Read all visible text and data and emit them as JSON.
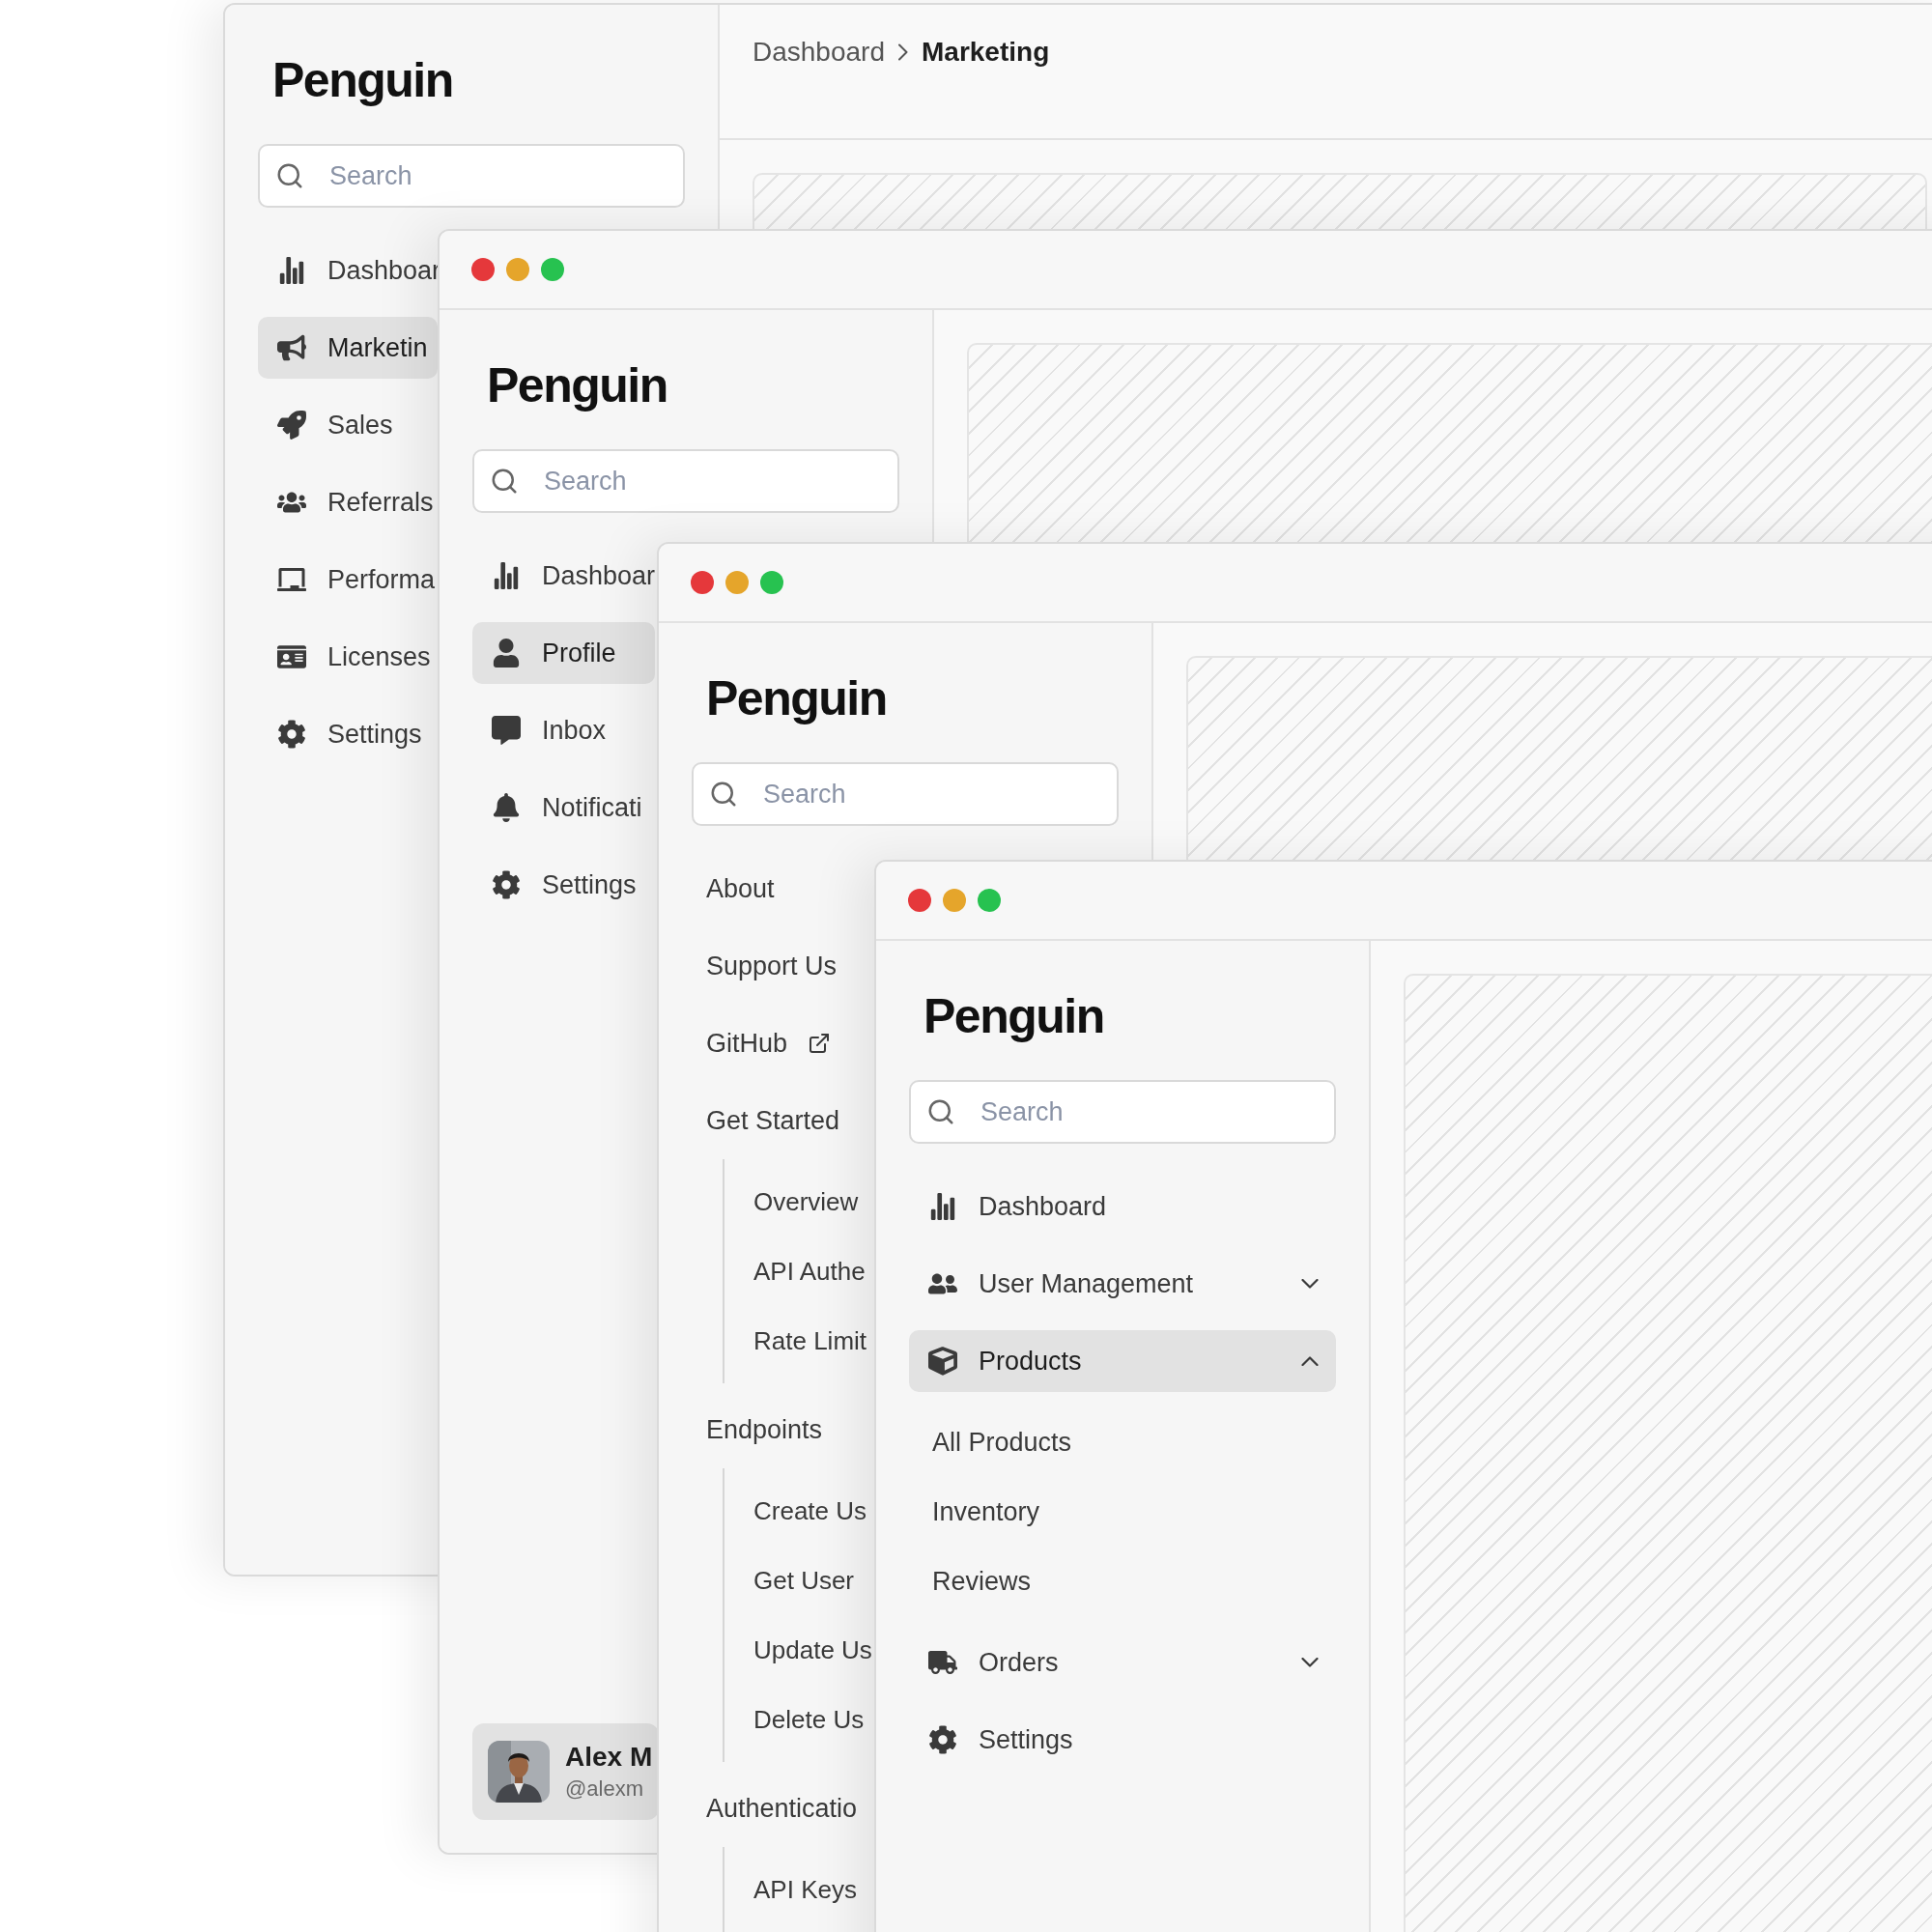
{
  "windows": [
    {
      "traffic_lights": false,
      "logo": "Penguin",
      "search": {
        "placeholder": "Search"
      },
      "breadcrumb": [
        {
          "label": "Dashboard",
          "current": false
        },
        {
          "label": "Marketing",
          "current": true
        }
      ],
      "nav": [
        {
          "kind": "nav",
          "label": "Dashboar",
          "selected": false
        },
        {
          "kind": "nav",
          "label": "Marketin",
          "selected": true
        },
        {
          "kind": "nav",
          "label": "Sales",
          "selected": false
        },
        {
          "kind": "nav",
          "label": "Referrals",
          "selected": false
        },
        {
          "kind": "nav",
          "label": "Performa",
          "selected": false
        },
        {
          "kind": "nav",
          "label": "Licenses",
          "selected": false
        },
        {
          "kind": "nav",
          "label": "Settings",
          "selected": false
        }
      ]
    },
    {
      "traffic_lights": true,
      "logo": "Penguin",
      "search": {
        "placeholder": "Search"
      },
      "nav": [
        {
          "kind": "nav",
          "label": "Dashboar",
          "selected": false
        },
        {
          "kind": "nav",
          "label": "Profile",
          "selected": true
        },
        {
          "kind": "nav",
          "label": "Inbox",
          "selected": false
        },
        {
          "kind": "nav",
          "label": "Notificati",
          "selected": false
        },
        {
          "kind": "nav",
          "label": "Settings",
          "selected": false
        }
      ],
      "user": {
        "name": "Alex M",
        "handle": "@alexm"
      }
    },
    {
      "traffic_lights": true,
      "logo": "Penguin",
      "search": {
        "placeholder": "Search"
      },
      "nav": [
        {
          "kind": "link",
          "label": "About",
          "selected": false
        },
        {
          "kind": "link",
          "label": "Support Us",
          "selected": false
        },
        {
          "kind": "external",
          "label": "GitHub",
          "selected": false
        },
        {
          "kind": "section",
          "label": "Get Started",
          "children": [
            {
              "label": "Overview",
              "selected": false
            },
            {
              "label": "API Authe",
              "selected": false
            },
            {
              "label": "Rate Limit",
              "selected": false
            }
          ]
        },
        {
          "kind": "section",
          "label": "Endpoints",
          "children": [
            {
              "label": "Create Us",
              "selected": false
            },
            {
              "label": "Get User",
              "selected": false
            },
            {
              "label": "Update Us",
              "selected": false
            },
            {
              "label": "Delete Us",
              "selected": false
            }
          ]
        },
        {
          "kind": "section",
          "label": "Authenticatio",
          "children": [
            {
              "label": "API Keys",
              "selected": false
            }
          ]
        }
      ]
    },
    {
      "traffic_lights": true,
      "logo": "Penguin",
      "search": {
        "placeholder": "Search"
      },
      "nav": [
        {
          "kind": "nav",
          "label": "Dashboard",
          "selected": false
        },
        {
          "kind": "group",
          "label": "User Management",
          "selected": false,
          "expanded": false
        },
        {
          "kind": "group",
          "label": "Products",
          "selected": true,
          "expanded": true,
          "children": [
            {
              "label": "All Products",
              "selected": false
            },
            {
              "label": "Inventory",
              "selected": false
            },
            {
              "label": "Reviews",
              "selected": false
            }
          ]
        },
        {
          "kind": "group",
          "label": "Orders",
          "selected": false,
          "expanded": false
        },
        {
          "kind": "nav",
          "label": "Settings",
          "selected": false
        }
      ]
    }
  ]
}
